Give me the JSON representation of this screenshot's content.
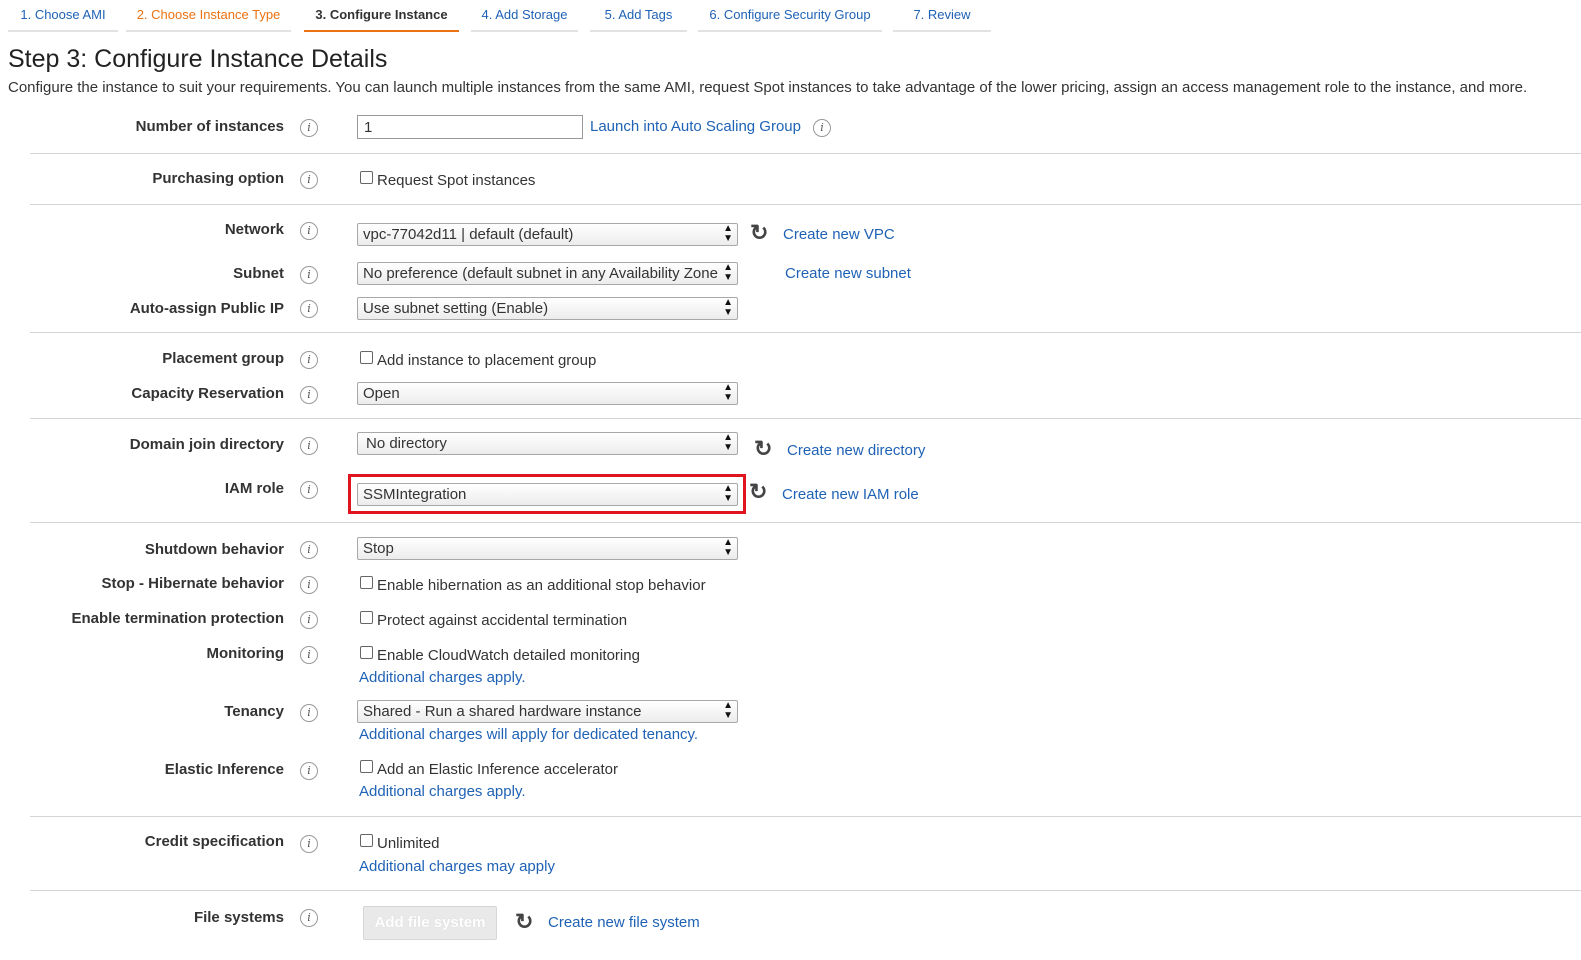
{
  "tabs": [
    "1. Choose AMI",
    "2. Choose Instance Type",
    "3. Configure Instance",
    "4. Add Storage",
    "5. Add Tags",
    "6. Configure Security Group",
    "7. Review"
  ],
  "title": "Step 3: Configure Instance Details",
  "description": "Configure the instance to suit your requirements. You can launch multiple instances from the same AMI, request Spot instances to take advantage of the lower pricing, assign an access management role to the instance, and more.",
  "info_glyph": "i",
  "refresh_glyph": "↻",
  "colors": {
    "accent": "#ec7211",
    "link": "#1f62b5",
    "highlight": "#e0141e"
  },
  "fields": {
    "number_of_instances": {
      "label": "Number of instances",
      "value": "1",
      "link": "Launch into Auto Scaling Group"
    },
    "purchasing_option": {
      "label": "Purchasing option",
      "checkbox": "Request Spot instances"
    },
    "network": {
      "label": "Network",
      "value": "vpc-77042d11 | default (default)",
      "link": "Create new VPC"
    },
    "subnet": {
      "label": "Subnet",
      "value": "No preference (default subnet in any Availability Zone)",
      "link": "Create new subnet"
    },
    "auto_assign_ip": {
      "label": "Auto-assign Public IP",
      "value": "Use subnet setting (Enable)"
    },
    "placement_group": {
      "label": "Placement group",
      "checkbox": "Add instance to placement group"
    },
    "capacity_reservation": {
      "label": "Capacity Reservation",
      "value": "Open"
    },
    "domain_join": {
      "label": "Domain join directory",
      "value": "No directory",
      "link": "Create new directory"
    },
    "iam_role": {
      "label": "IAM role",
      "value": "SSMIntegration",
      "link": "Create new IAM role"
    },
    "shutdown_behavior": {
      "label": "Shutdown behavior",
      "value": "Stop"
    },
    "hibernate": {
      "label": "Stop - Hibernate behavior",
      "checkbox": "Enable hibernation as an additional stop behavior"
    },
    "termination": {
      "label": "Enable termination protection",
      "checkbox": "Protect against accidental termination"
    },
    "monitoring": {
      "label": "Monitoring",
      "checkbox": "Enable CloudWatch detailed monitoring",
      "note": "Additional charges apply."
    },
    "tenancy": {
      "label": "Tenancy",
      "value": "Shared - Run a shared hardware instance",
      "note": "Additional charges will apply for dedicated tenancy."
    },
    "elastic_inference": {
      "label": "Elastic Inference",
      "checkbox": "Add an Elastic Inference accelerator",
      "note": "Additional charges apply."
    },
    "credit_spec": {
      "label": "Credit specification",
      "checkbox": "Unlimited",
      "note": "Additional charges may apply"
    },
    "file_systems": {
      "label": "File systems",
      "button": "Add file system",
      "link": "Create new file system"
    }
  }
}
